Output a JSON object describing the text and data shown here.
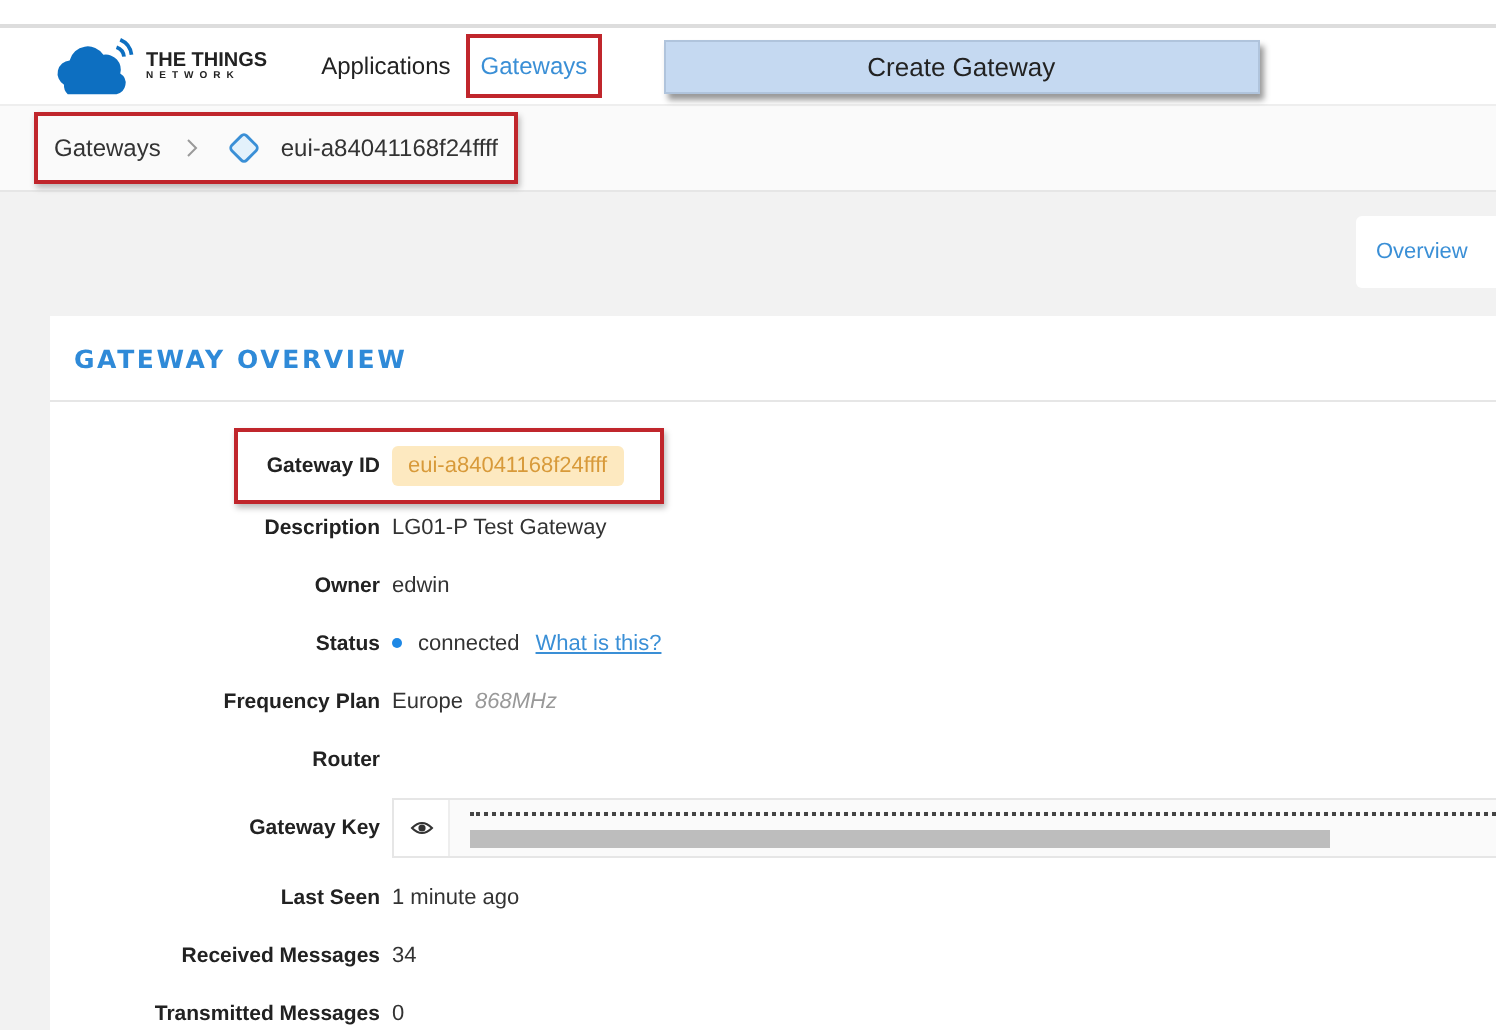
{
  "header": {
    "logo": {
      "line1": "THE THINGS",
      "line2": "NETWORK"
    },
    "nav": [
      {
        "label": "Applications",
        "selected": false,
        "highlighted": false
      },
      {
        "label": "Gateways",
        "selected": true,
        "highlighted": true
      }
    ],
    "create_button": "Create Gateway"
  },
  "breadcrumb": {
    "highlighted": true,
    "items": [
      {
        "label": "Gateways",
        "kind": "link"
      },
      {
        "label": "eui-a84041168f24ffff",
        "kind": "current"
      }
    ]
  },
  "tabs": [
    {
      "label": "Overview",
      "selected": true
    }
  ],
  "card": {
    "title": "GATEWAY OVERVIEW",
    "rows": [
      {
        "label": "Gateway ID",
        "kind": "badge",
        "value": "eui-a84041168f24ffff",
        "highlighted": true
      },
      {
        "label": "Description",
        "kind": "text",
        "value": "LG01-P Test Gateway"
      },
      {
        "label": "Owner",
        "kind": "text",
        "value": "edwin"
      },
      {
        "label": "Status",
        "kind": "status",
        "value": "connected",
        "color": "#1e88e5",
        "link": "What is this?"
      },
      {
        "label": "Frequency Plan",
        "kind": "freq",
        "value": "Europe",
        "note": "868MHz"
      },
      {
        "label": "Router",
        "kind": "empty"
      },
      {
        "label": "Gateway Key",
        "kind": "secret"
      },
      {
        "label": "Last Seen",
        "kind": "text",
        "value": "1 minute ago"
      },
      {
        "label": "Received Messages",
        "kind": "text",
        "value": "34"
      },
      {
        "label": "Transmitted Messages",
        "kind": "text",
        "value": "0"
      }
    ]
  }
}
